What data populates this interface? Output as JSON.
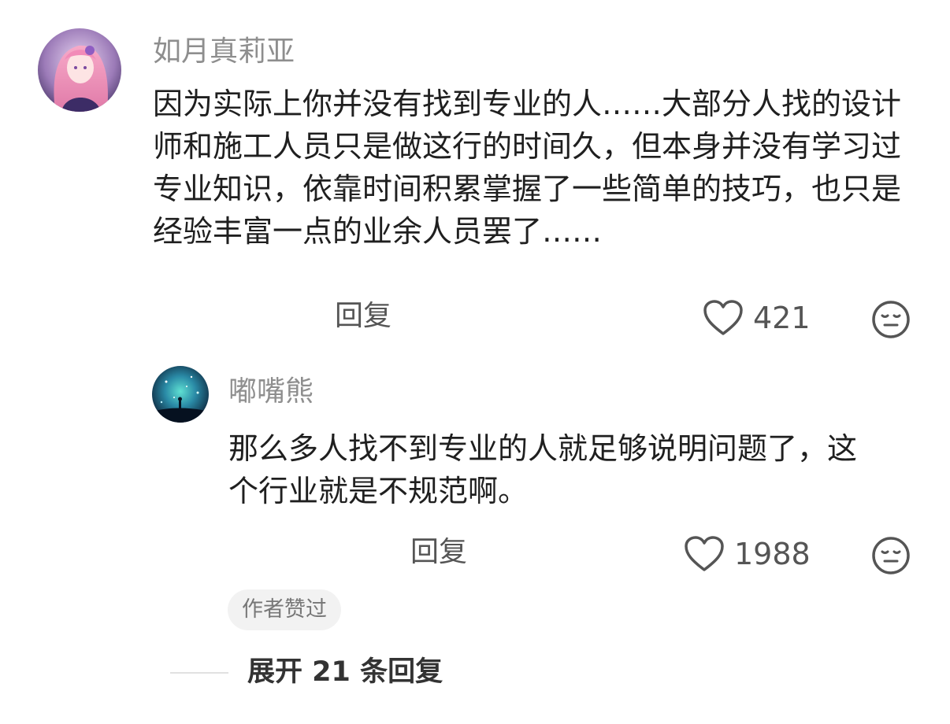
{
  "comment": {
    "username": "如月真莉亚",
    "text": "因为实际上你并没有找到专业的人……大部分人找的设计师和施工人员只是做这行的时间久，但本身并没有学习过专业知识，依靠时间积累掌握了一些简单的技巧，也只是经验丰富一点的业余人员罢了……",
    "reply_label": "回复",
    "like_count": "421",
    "icons": {
      "avatar": "anime-girl-avatar",
      "like": "heart-icon",
      "dislike": "meh-face-icon"
    }
  },
  "reply": {
    "username": "嘟嘴熊",
    "text": "那么多人找不到专业的人就足够说明问题了，这个行业就是不规范啊。",
    "reply_label": "回复",
    "like_count": "1988",
    "author_badge": "作者赞过",
    "icons": {
      "avatar": "starry-night-avatar",
      "like": "heart-icon",
      "dislike": "meh-face-icon"
    }
  },
  "expand_replies": "展开 21 条回复",
  "colors": {
    "username": "#8e8e8e",
    "text": "#1f1f1f",
    "muted": "#555555",
    "badge_bg": "#f2f2f2"
  }
}
